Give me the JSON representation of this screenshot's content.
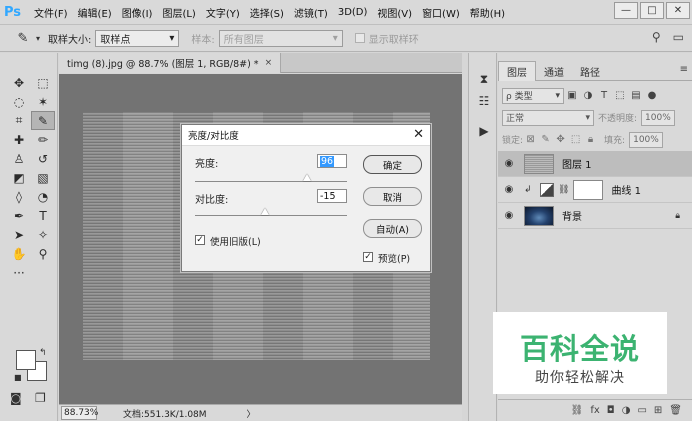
{
  "app": {
    "logo": "Ps"
  },
  "menu": [
    "文件(F)",
    "编辑(E)",
    "图像(I)",
    "图层(L)",
    "文字(Y)",
    "选择(S)",
    "滤镜(T)",
    "3D(D)",
    "视图(V)",
    "窗口(W)",
    "帮助(H)"
  ],
  "window_controls": {
    "minimize": "—",
    "restore": "□",
    "close": "✕"
  },
  "options": {
    "tool_icon": "eyedropper-icon",
    "sample_size_label": "取样大小:",
    "sample_size_value": "取样点",
    "sample_label": "样本:",
    "sample_value": "所有图层",
    "show_ring_label": "显示取样环"
  },
  "document": {
    "tab_title": "timg (8).jpg @ 88.7% (图层 1, RGB/8#) *",
    "tab_close": "×",
    "zoom": "88.73%",
    "doc_info": "文档:551.3K/1.08M",
    "status_arrow": "〉"
  },
  "dialog": {
    "title": "亮度/对比度",
    "brightness_label": "亮度:",
    "brightness_value": "96",
    "brightness_level": 0.74,
    "contrast_label": "对比度:",
    "contrast_value": "-15",
    "contrast_level": 0.46,
    "use_legacy_label": "使用旧版(L)",
    "use_legacy_checked": true,
    "ok_label": "确定",
    "cancel_label": "取消",
    "auto_label": "自动(A)",
    "preview_label": "预览(P)",
    "preview_checked": true
  },
  "layers_panel": {
    "tabs": [
      "图层",
      "通道",
      "路径"
    ],
    "filter_kind": "ρ 类型",
    "blend_mode": "正常",
    "opacity_label": "不透明度:",
    "opacity_value": "100%",
    "lock_label": "锁定:",
    "fill_label": "填充:",
    "fill_value": "100%",
    "layers": [
      {
        "name": "图层 1",
        "selected": true
      },
      {
        "name": "曲线 1",
        "selected": false
      },
      {
        "name": "背景",
        "selected": false
      }
    ]
  },
  "watermark": {
    "title": "百科全说",
    "subtitle": "助你轻松解决"
  }
}
